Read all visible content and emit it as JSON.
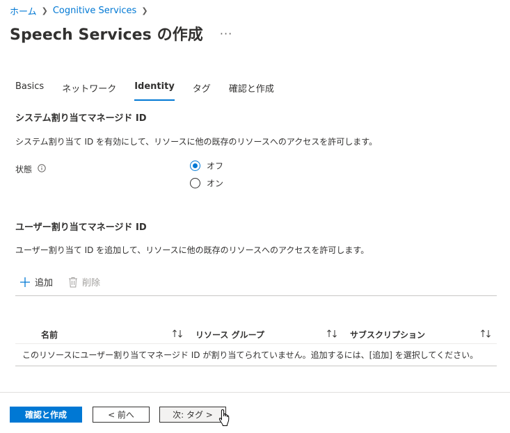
{
  "breadcrumb": {
    "items": [
      {
        "label": "ホーム"
      },
      {
        "label": "Cognitive Services"
      }
    ]
  },
  "header": {
    "title": "Speech Services の作成",
    "more_label": "···"
  },
  "tabs": [
    {
      "label": "Basics"
    },
    {
      "label": "ネットワーク"
    },
    {
      "label": "Identity",
      "active": true
    },
    {
      "label": "タグ"
    },
    {
      "label": "確認と作成"
    }
  ],
  "system_identity": {
    "heading": "システム割り当てマネージド ID",
    "description": "システム割り当て ID を有効にして、リソースに他の既存のリソースへのアクセスを許可します。",
    "status_label": "状態",
    "options": [
      {
        "label": "オフ",
        "selected": true
      },
      {
        "label": "オン",
        "selected": false
      }
    ]
  },
  "user_identity": {
    "heading": "ユーザー割り当てマネージド ID",
    "description": "ユーザー割り当て ID を追加して、リソースに他の既存のリソースへのアクセスを許可します。",
    "toolbar": {
      "add_label": "追加",
      "delete_label": "削除"
    },
    "table": {
      "columns": [
        "名前",
        "リソース グループ",
        "サブスクリプション"
      ],
      "empty_message": "このリソースにユーザー割り当てマネージド ID が割り当てられていません。追加するには、[追加] を選択してください。"
    }
  },
  "footer": {
    "review_create_label": "確認と作成",
    "prev_label": "< 前へ",
    "next_label": "次: タグ >"
  },
  "colors": {
    "accent": "#0078d4",
    "text": "#323130",
    "disabled": "#a19f9d"
  },
  "icons": {
    "info": "info-icon",
    "add": "plus-icon",
    "delete": "trash-icon",
    "sort": "sort-icon",
    "cursor": "hand-cursor-icon"
  }
}
